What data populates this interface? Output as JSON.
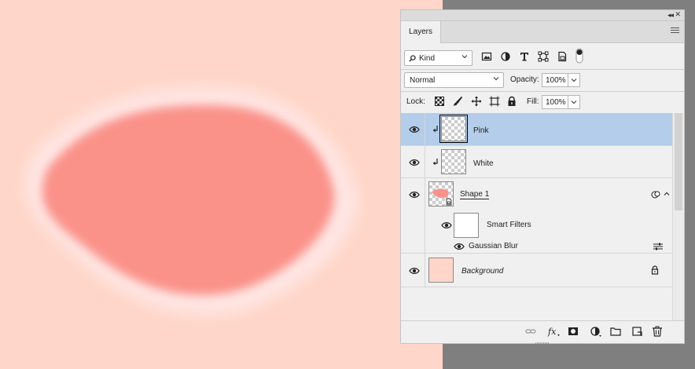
{
  "panel": {
    "tab_label": "Layers"
  },
  "filter": {
    "kind_label": "Kind",
    "icons": [
      "image-filter-icon",
      "adjustment-filter-icon",
      "type-filter-icon",
      "shape-filter-icon",
      "smart-object-filter-icon",
      "filter-toggle-icon"
    ]
  },
  "blend": {
    "mode": "Normal",
    "opacity_label": "Opacity:",
    "opacity_value": "100%"
  },
  "lock": {
    "label": "Lock:",
    "icons": [
      "lock-transparent-pixels-icon",
      "lock-image-pixels-icon",
      "lock-position-icon",
      "lock-artboard-icon",
      "lock-all-icon"
    ],
    "fill_label": "Fill:",
    "fill_value": "100%"
  },
  "layers": [
    {
      "name": "Pink",
      "selected": true,
      "clipped": true,
      "visible": true
    },
    {
      "name": "White",
      "selected": false,
      "clipped": true,
      "visible": true
    },
    {
      "name": "Shape 1",
      "selected": false,
      "clipped": false,
      "visible": true,
      "smart_object": true
    },
    {
      "name": "Smart Filters",
      "visible": true
    },
    {
      "name": "Gaussian Blur",
      "visible": true
    },
    {
      "name": "Background",
      "selected": false,
      "locked": true,
      "visible": true
    }
  ],
  "bottom_icons": [
    "link-layers-icon",
    "fx-icon",
    "add-mask-icon",
    "adjustment-layer-icon",
    "new-group-icon",
    "new-layer-icon",
    "delete-layer-icon"
  ],
  "colors": {
    "canvas_bg": "#ffd6c9",
    "blob_fill": "#fa9289",
    "blob_rim": "#ffe8e8",
    "selection": "#b3cdea"
  }
}
